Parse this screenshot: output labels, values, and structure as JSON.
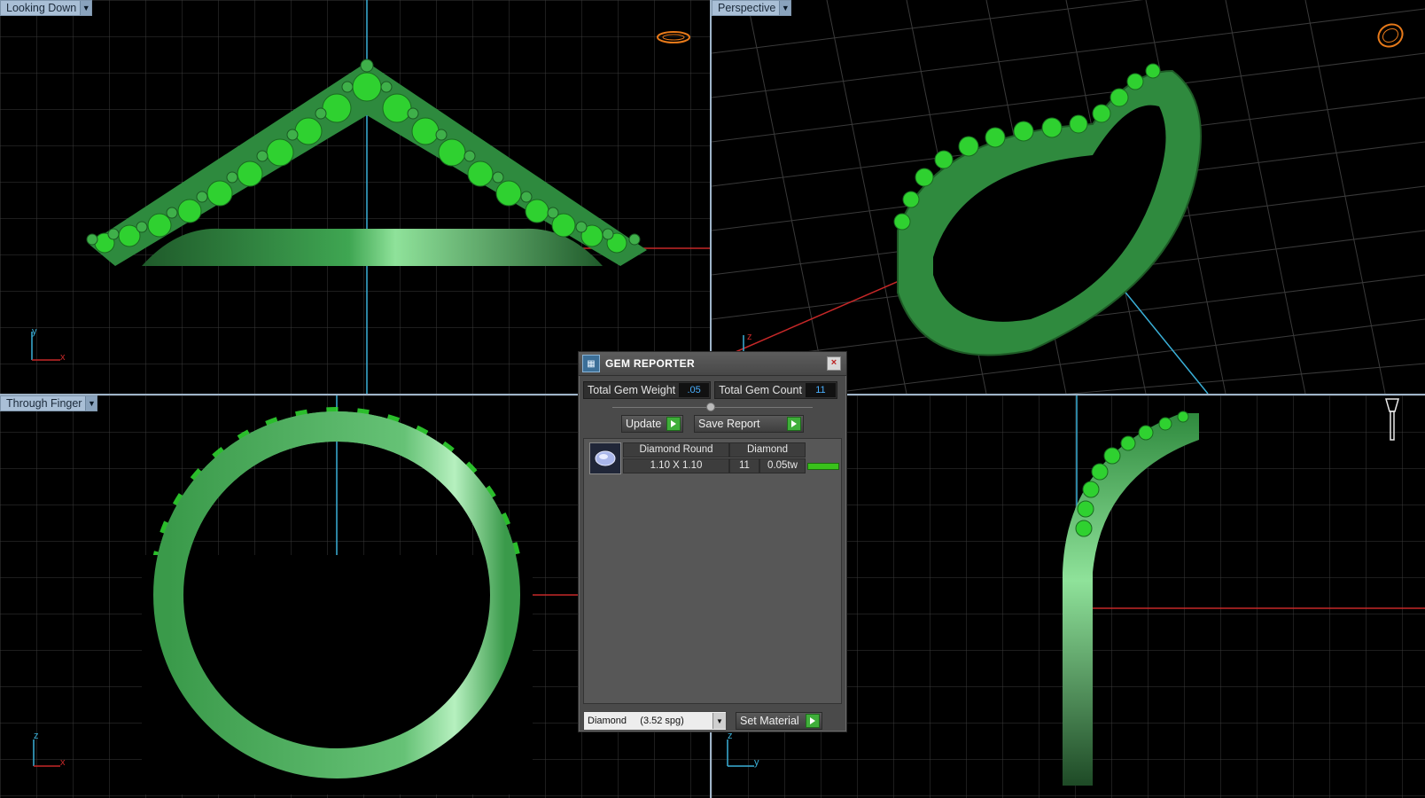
{
  "viewports": {
    "top_left": {
      "label": "Looking Down",
      "axes": [
        "y",
        "x"
      ]
    },
    "top_right": {
      "label": "Perspective",
      "axes": [
        "z"
      ]
    },
    "bottom_left": {
      "label": "Through Finger",
      "axes": [
        "z",
        "x"
      ]
    },
    "bottom_right": {
      "label": "",
      "axes": [
        "z",
        "y"
      ]
    }
  },
  "gem_reporter": {
    "title": "GEM REPORTER",
    "total_weight_label": "Total Gem Weight",
    "total_weight_value": ".05",
    "total_count_label": "Total Gem Count",
    "total_count_value": "11",
    "update_label": "Update",
    "save_report_label": "Save Report",
    "gem": {
      "shape": "Diamond Round",
      "material": "Diamond",
      "size": "1.10 X 1.10",
      "count": "11",
      "weight": "0.05tw",
      "color": "#39c21b"
    },
    "material_select": "Diamond     (3.52 spg)",
    "set_material_label": "Set Material"
  },
  "colors": {
    "ring": "#3a9a4a",
    "gems": "#2fd130",
    "grid": "#3a3a3a",
    "axis_x": "#c62828",
    "axis_y": "#3ab0d8",
    "accent": "#e87a1a"
  }
}
